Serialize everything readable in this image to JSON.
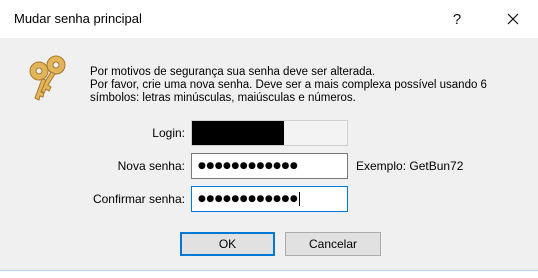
{
  "window": {
    "title": "Mudar senha principal",
    "help_label": "?",
    "close_icon": "close-icon"
  },
  "icon": {
    "name": "keys-icon",
    "color": "#e0b050"
  },
  "message": {
    "line1": "Por motivos de segurança sua senha deve ser alterada.",
    "line2": "Por favor, crie uma nova senha. Deve ser a mais complexa possível usando 6",
    "line3": "símbolos: letras minúsculas, maiúsculas e números."
  },
  "form": {
    "login_label": "Login:",
    "login_value": "",
    "new_password_label": "Nova senha:",
    "new_password_value": "●●●●●●●●●●●●",
    "confirm_password_label": "Confirmar senha:",
    "confirm_password_value": "●●●●●●●●●●●●",
    "example_text": "Exemplo: GetBun72"
  },
  "buttons": {
    "ok_label": "OK",
    "cancel_label": "Cancelar"
  },
  "colors": {
    "accent": "#0078d7",
    "dialog_bg": "#f0f0f0"
  }
}
